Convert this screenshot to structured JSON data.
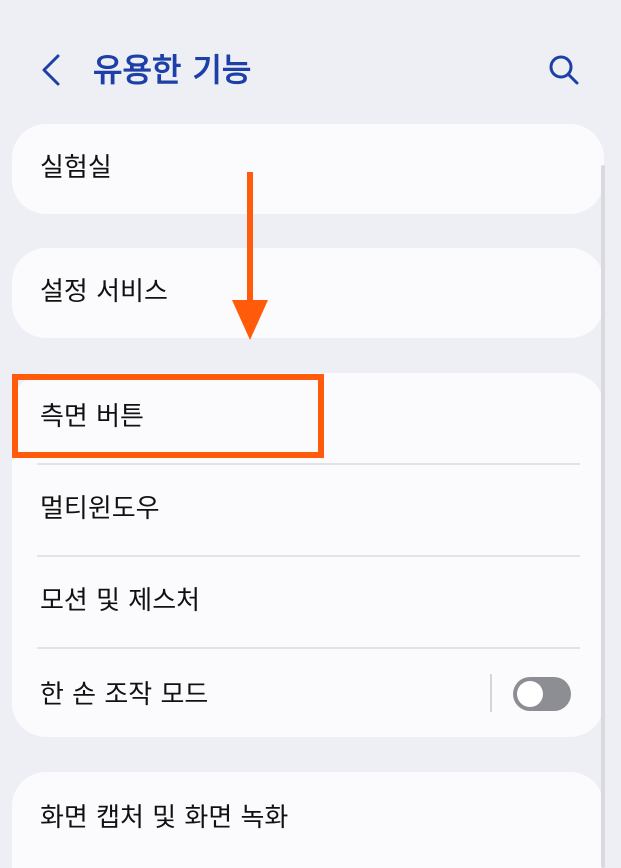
{
  "header": {
    "back_icon": "chevron-left-icon",
    "title": "유용한 기능",
    "search_icon": "search-icon"
  },
  "cards": {
    "labs": {
      "label": "실험실"
    },
    "settings_services": {
      "label": "설정 서비스"
    },
    "features": {
      "items": [
        {
          "label": "측면 버튼"
        },
        {
          "label": "멀티윈도우"
        },
        {
          "label": "모션 및 제스처"
        },
        {
          "label": "한 손 조작 모드",
          "toggle": false
        }
      ]
    },
    "screen_capture": {
      "label": "화면 캡처 및 화면 녹화"
    }
  },
  "annotation": {
    "arrow_icon": "down-arrow-icon",
    "highlight_color": "#ff5b0a"
  },
  "colors": {
    "background": "#eeeff5",
    "card": "#fbfbfd",
    "title": "#1d3fa8",
    "accent": "#ff5b0a",
    "toggle_off": "#8d8d94"
  }
}
